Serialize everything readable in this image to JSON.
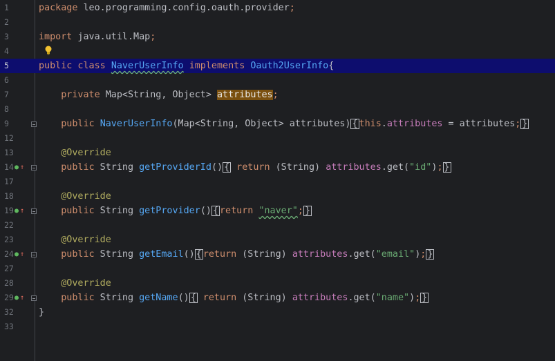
{
  "colors": {
    "background": "#1e1f22",
    "current_line": "#0d0d6e",
    "keyword": "#cf8e6d",
    "class_name": "#56a8f5",
    "field": "#c77dbb",
    "string": "#6aab73",
    "annotation": "#b3ae60",
    "highlight": "#7a5010"
  },
  "icons": {
    "intention": "lightbulb-icon",
    "implements_marker": "implemented-method-icon",
    "fold": "fold-icon"
  },
  "lines": [
    {
      "no": "1",
      "tokens": [
        [
          "kw",
          "package"
        ],
        [
          "plain",
          " leo.programming.config.oauth.provider"
        ],
        [
          "sem",
          ";"
        ]
      ]
    },
    {
      "no": "2",
      "tokens": []
    },
    {
      "no": "3",
      "tokens": [
        [
          "kw",
          "import"
        ],
        [
          "plain",
          " java.util.Map"
        ],
        [
          "sem",
          ";"
        ]
      ]
    },
    {
      "no": "4",
      "tokens": [],
      "bulb": true
    },
    {
      "no": "5",
      "current": true,
      "tokens": [
        [
          "kw",
          "public class "
        ],
        [
          "cls-wavy",
          "NaverUserInfo"
        ],
        [
          "plain",
          " "
        ],
        [
          "kw",
          "implements"
        ],
        [
          "plain",
          " "
        ],
        [
          "cls",
          "Oauth2UserInfo"
        ],
        [
          "plain",
          "{"
        ]
      ]
    },
    {
      "no": "6",
      "tokens": []
    },
    {
      "no": "7",
      "tokens": [
        [
          "plain",
          "    "
        ],
        [
          "kw",
          "private"
        ],
        [
          "plain",
          " Map<String, Object> "
        ],
        [
          "hl",
          "attributes"
        ],
        [
          "sem",
          ";"
        ]
      ]
    },
    {
      "no": "8",
      "tokens": []
    },
    {
      "no": "9",
      "fold": true,
      "tokens": [
        [
          "plain",
          "    "
        ],
        [
          "kw",
          "public"
        ],
        [
          "plain",
          " "
        ],
        [
          "fn",
          "NaverUserInfo"
        ],
        [
          "plain",
          "(Map<String, Object> attributes)"
        ],
        [
          "box",
          "{"
        ],
        [
          "kw",
          "this"
        ],
        [
          "plain",
          "."
        ],
        [
          "field",
          "attributes"
        ],
        [
          "plain",
          " = attributes"
        ],
        [
          "sem",
          ";"
        ],
        [
          "box",
          "}"
        ]
      ]
    },
    {
      "no": "12",
      "tokens": []
    },
    {
      "no": "13",
      "tokens": [
        [
          "plain",
          "    "
        ],
        [
          "ann",
          "@Override"
        ]
      ]
    },
    {
      "no": "14",
      "impl": true,
      "fold": true,
      "tokens": [
        [
          "plain",
          "    "
        ],
        [
          "kw",
          "public"
        ],
        [
          "plain",
          " String "
        ],
        [
          "fn",
          "getProviderId"
        ],
        [
          "plain",
          "()"
        ],
        [
          "box",
          "{"
        ],
        [
          "kw",
          " return"
        ],
        [
          "plain",
          " (String) "
        ],
        [
          "field",
          "attributes"
        ],
        [
          "plain",
          ".get("
        ],
        [
          "str",
          "\"id\""
        ],
        [
          "plain",
          ")"
        ],
        [
          "sem",
          ";"
        ],
        [
          "box",
          "}"
        ]
      ]
    },
    {
      "no": "17",
      "tokens": []
    },
    {
      "no": "18",
      "tokens": [
        [
          "plain",
          "    "
        ],
        [
          "ann",
          "@Override"
        ]
      ]
    },
    {
      "no": "19",
      "impl": true,
      "fold": true,
      "tokens": [
        [
          "plain",
          "    "
        ],
        [
          "kw",
          "public"
        ],
        [
          "plain",
          " String "
        ],
        [
          "fn",
          "getProvider"
        ],
        [
          "plain",
          "()"
        ],
        [
          "box",
          "{"
        ],
        [
          "kw",
          "return"
        ],
        [
          "plain",
          " "
        ],
        [
          "str-wavy",
          "\"naver\""
        ],
        [
          "sem",
          ";"
        ],
        [
          "box",
          "}"
        ]
      ]
    },
    {
      "no": "22",
      "tokens": []
    },
    {
      "no": "23",
      "tokens": [
        [
          "plain",
          "    "
        ],
        [
          "ann",
          "@Override"
        ]
      ]
    },
    {
      "no": "24",
      "impl": true,
      "fold": true,
      "tokens": [
        [
          "plain",
          "    "
        ],
        [
          "kw",
          "public"
        ],
        [
          "plain",
          " String "
        ],
        [
          "fn",
          "getEmail"
        ],
        [
          "plain",
          "()"
        ],
        [
          "box",
          "{"
        ],
        [
          "kw",
          "return"
        ],
        [
          "plain",
          " (String) "
        ],
        [
          "field",
          "attributes"
        ],
        [
          "plain",
          ".get("
        ],
        [
          "str",
          "\"email\""
        ],
        [
          "plain",
          ")"
        ],
        [
          "sem",
          ";"
        ],
        [
          "box",
          "}"
        ]
      ]
    },
    {
      "no": "27",
      "tokens": []
    },
    {
      "no": "28",
      "tokens": [
        [
          "plain",
          "    "
        ],
        [
          "ann",
          "@Override"
        ]
      ]
    },
    {
      "no": "29",
      "impl": true,
      "fold": true,
      "tokens": [
        [
          "plain",
          "    "
        ],
        [
          "kw",
          "public"
        ],
        [
          "plain",
          " String "
        ],
        [
          "fn",
          "getName"
        ],
        [
          "plain",
          "()"
        ],
        [
          "box",
          "{"
        ],
        [
          "kw",
          " return"
        ],
        [
          "plain",
          " (String) "
        ],
        [
          "field",
          "attributes"
        ],
        [
          "plain",
          ".get("
        ],
        [
          "str",
          "\"name\""
        ],
        [
          "plain",
          ")"
        ],
        [
          "sem",
          ";"
        ],
        [
          "box",
          "}"
        ]
      ]
    },
    {
      "no": "32",
      "tokens": [
        [
          "plain",
          "}"
        ]
      ]
    },
    {
      "no": "33",
      "tokens": []
    }
  ]
}
